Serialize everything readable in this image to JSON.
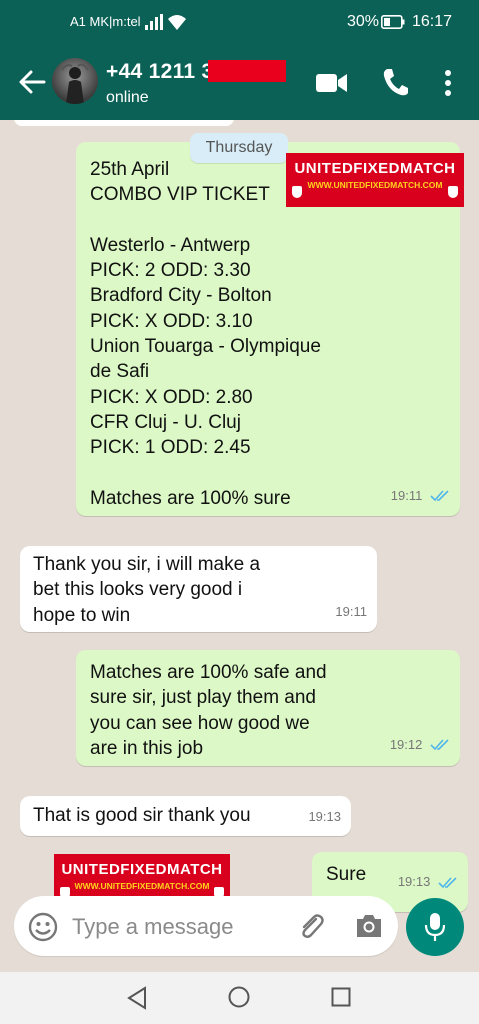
{
  "status_bar": {
    "carrier": "A1 MK|m:tel",
    "battery": "30%",
    "time": "16:17"
  },
  "header": {
    "contact_name": "+44 1211 3",
    "contact_status": "online"
  },
  "chat": {
    "day_label": "Thursday",
    "messages": [
      {
        "direction": "outgoing",
        "text": "25th April\nCOMBO VIP TICKET\n\nWesterlo - Antwerp\nPICK: 2 ODD: 3.30\nBradford City - Bolton\nPICK: X ODD: 3.10\nUnion Touarga - Olympique\nde Safi\nPICK: X ODD: 2.80\nCFR Cluj - U. Cluj\nPICK: 1 ODD: 2.45\n\nMatches are 100% sure",
        "time": "19:11",
        "read": true
      },
      {
        "direction": "incoming",
        "text": "Thank you sir, i will make a\nbet this looks very good i\nhope to win",
        "time": "19:11"
      },
      {
        "direction": "outgoing",
        "text": "Matches are 100% safe and\nsure sir, just play them and\nyou can see how good we\nare in this job",
        "time": "19:12",
        "read": true
      },
      {
        "direction": "incoming",
        "text": "That is good sir thank you",
        "time": "19:13"
      },
      {
        "direction": "outgoing",
        "text": "Sure",
        "time": "19:13",
        "read": true
      }
    ]
  },
  "watermark": {
    "title": "UNITEDFIXEDMATCH",
    "url": "WWW.UNITEDFIXEDMATCH.COM"
  },
  "composer": {
    "placeholder": "Type a message"
  },
  "colors": {
    "header": "#0b6156",
    "outgoing_bubble": "#dcf8c6",
    "incoming_bubble": "#ffffff",
    "chat_background": "#e5ddd5",
    "mic_button": "#00897b",
    "read_ticks": "#4fb6ec",
    "watermark_red": "#d8001c"
  },
  "icons": [
    "back-arrow-icon",
    "video-call-icon",
    "phone-icon",
    "more-vert-icon",
    "emoji-icon",
    "attach-icon",
    "camera-icon",
    "mic-icon",
    "nav-back-icon",
    "nav-home-icon",
    "nav-recents-icon",
    "double-check-icon"
  ]
}
